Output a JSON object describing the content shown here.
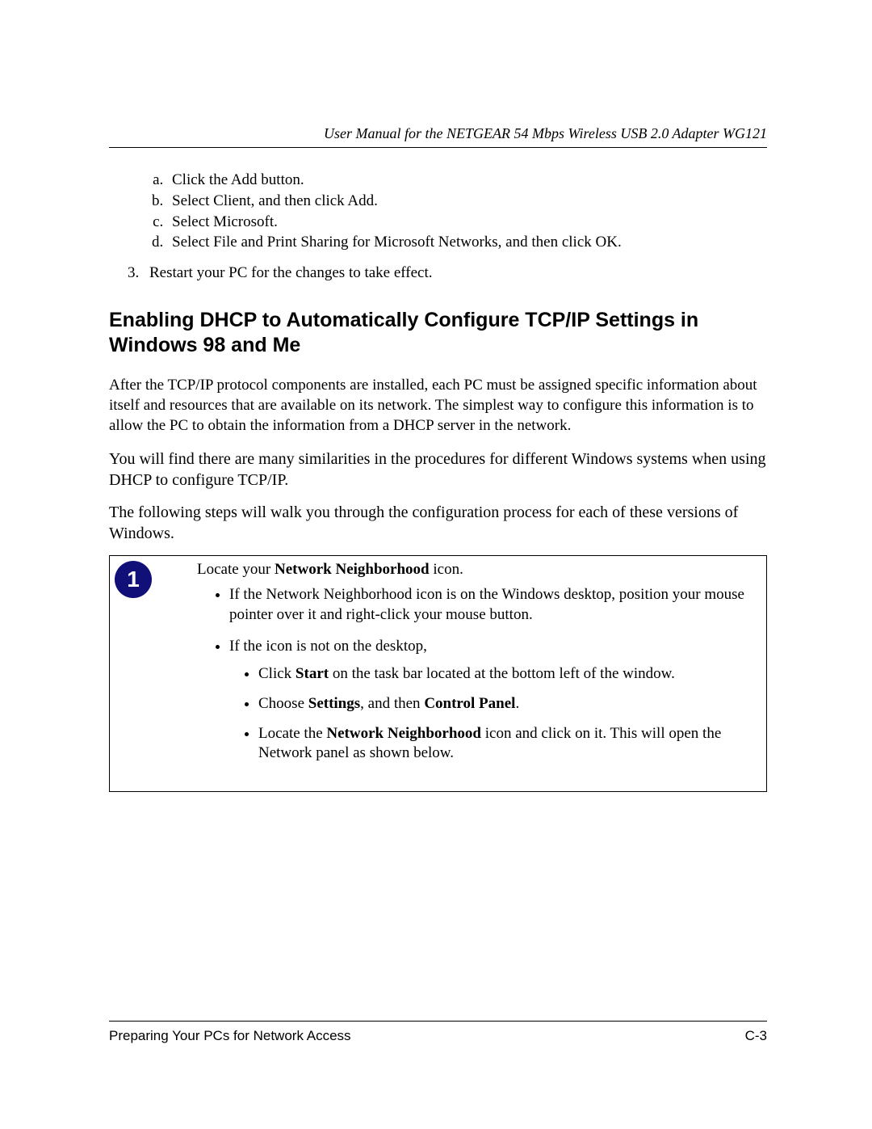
{
  "header": {
    "title": "User Manual for the NETGEAR 54 Mbps Wireless USB 2.0 Adapter WG121"
  },
  "alpha_list": {
    "a": "Click the Add button.",
    "b": "Select Client, and then click Add.",
    "c": "Select Microsoft.",
    "d": "Select File and Print Sharing for Microsoft Networks, and then click OK."
  },
  "num_list": {
    "item3": "Restart your PC for the changes to take effect."
  },
  "heading": "Enabling DHCP to Automatically Configure TCP/IP Settings in Windows 98 and Me",
  "para1": "After the TCP/IP protocol components are installed, each PC must be assigned specific information about itself and resources that are available on its network. The simplest way to configure this information is to allow the PC to obtain the information from a DHCP server in the network.",
  "para2": "You will find there are many similarities in the procedures for different Windows systems when using DHCP to configure TCP/IP.",
  "para3": "The following steps will walk you through the configuration process for each of these versions of Windows.",
  "step": {
    "number": "1",
    "intro_pre": "Locate your ",
    "intro_bold": "Network Neighborhood",
    "intro_post": " icon.",
    "b1": "If the Network Neighborhood icon is on the Windows desktop, position your mouse pointer over it and right-click your mouse button.",
    "b2": "If the icon is not on the desktop,",
    "s1_pre": "Click ",
    "s1_b1": "Start",
    "s1_post": " on the task bar located at the bottom left of the window.",
    "s2_pre": "Choose ",
    "s2_b1": "Settings",
    "s2_mid": ", and then ",
    "s2_b2": "Control Panel",
    "s2_post": ".",
    "s3_pre": "Locate the ",
    "s3_b1": "Network Neighborhood",
    "s3_post": " icon and click on it. This will open the Network panel as shown below."
  },
  "footer": {
    "left": "Preparing Your PCs for Network Access",
    "right": "C-3"
  }
}
